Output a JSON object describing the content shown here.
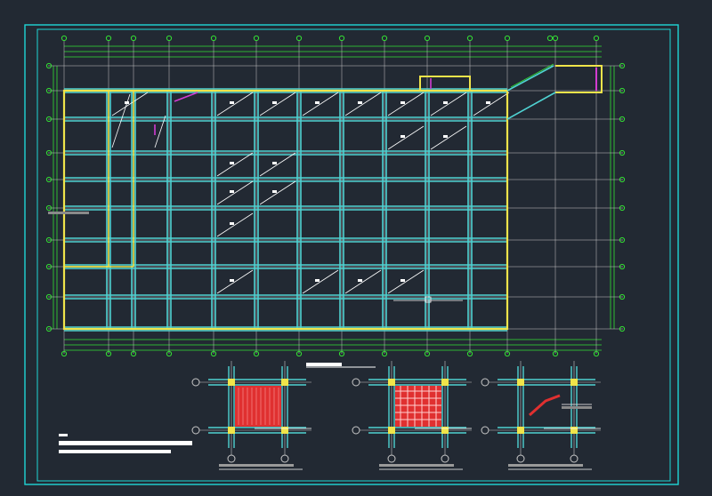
{
  "drawing": {
    "background": "#222933",
    "border_color": "#1fd6d6",
    "grid_color": "#c8c8c8",
    "beam_color": "#4fd2d2",
    "green_color": "#34e034",
    "outline_color": "#f0e44a",
    "accent_color": "#e03030",
    "magenta_color": "#d23cd2",
    "bubble_columns": 15,
    "bubble_rows": 10
  },
  "main_plan": {
    "bay_columns": 10,
    "bay_rows": 9
  },
  "details": [
    {
      "id": "detail-1",
      "infill": "hatched"
    },
    {
      "id": "detail-2",
      "infill": "grid"
    },
    {
      "id": "detail-3",
      "infill": "bracket"
    }
  ]
}
